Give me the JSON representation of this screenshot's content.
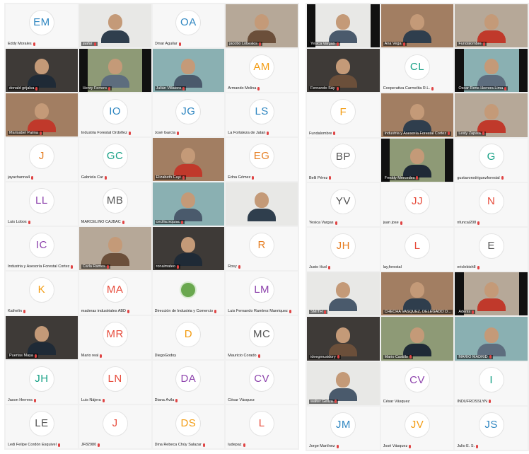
{
  "left_gallery": {
    "tiles": [
      {
        "initials": "EM",
        "name": "Eddy Morales",
        "initials_color": "#2e86c1",
        "mic_muted": true
      },
      {
        "name": "jaafar",
        "video": true,
        "active": true,
        "mic_muted": true
      },
      {
        "initials": "OA",
        "name": "Omar Aguilar",
        "initials_color": "#2e86c1",
        "mic_muted": true
      },
      {
        "name": "jacobo Lobeslos",
        "video": true,
        "mic_muted": true
      },
      {
        "name": "donald grijalva",
        "video": true,
        "mic_muted": true
      },
      {
        "name": "Henry Ferrero",
        "video": true,
        "mic_muted": true
      },
      {
        "name": "Julián Villatoro",
        "video": true,
        "mic_muted": true
      },
      {
        "initials": "AM",
        "name": "Armando Molina",
        "initials_color": "#f39c12",
        "mic_muted": true
      },
      {
        "name": "Marisabel Palma",
        "video": true,
        "mic_muted": true
      },
      {
        "initials": "IO",
        "name": "Industria Forestal Ordoñez",
        "initials_color": "#2e86c1",
        "mic_muted": true
      },
      {
        "initials": "JG",
        "name": "José García",
        "initials_color": "#2e86c1",
        "mic_muted": true
      },
      {
        "initials": "LS",
        "name": "La Fortaleza de Jatan",
        "initials_color": "#2e86c1",
        "mic_muted": true
      },
      {
        "initials": "J",
        "name": "jayachanna4",
        "initials_color": "#e67e22",
        "mic_muted": true
      },
      {
        "initials": "GC",
        "name": "Gabriela Car",
        "initials_color": "#16a085",
        "mic_muted": true
      },
      {
        "name": "Elizabeth Cuyi",
        "video": true,
        "mic_muted": true
      },
      {
        "initials": "EG",
        "name": "Edna Gómez",
        "initials_color": "#e67e22",
        "mic_muted": true
      },
      {
        "initials": "LL",
        "name": "Luis Lobos",
        "initials_color": "#8e44ad",
        "mic_muted": true
      },
      {
        "initials": "MB",
        "name": "MARCELINO CAJBAC",
        "initials_color": "#555555",
        "mic_muted": true
      },
      {
        "name": "cecilia.ixquiac",
        "video": true,
        "mic_muted": true
      },
      {
        "name": "",
        "video": true,
        "mic_muted": false
      },
      {
        "initials": "IC",
        "name": "Industria y Asesoría Forestal Cortez",
        "initials_color": "#8e44ad",
        "mic_muted": true
      },
      {
        "name": "Carla Ramos",
        "video": true,
        "mic_muted": true
      },
      {
        "name": "ronaimateo",
        "video": true,
        "mic_muted": true
      },
      {
        "initials": "R",
        "name": "Rosy",
        "initials_color": "#e67e22",
        "mic_muted": true
      },
      {
        "initials": "K",
        "name": "Kathelin",
        "initials_color": "#f39c12",
        "mic_muted": true
      },
      {
        "initials": "MA",
        "name": "maderas industriales ABD",
        "initials_color": "#e74c3c",
        "mic_muted": true
      },
      {
        "name": "Dirección de Industria y Comercio",
        "logo": true,
        "mic_muted": true
      },
      {
        "initials": "LM",
        "name": "Luis Fernando Ramírez Manriquez",
        "initials_color": "#8e44ad",
        "mic_muted": true
      },
      {
        "name": "Puertas Maya",
        "video": true,
        "mic_muted": true
      },
      {
        "initials": "MR",
        "name": "Mario real",
        "initials_color": "#e74c3c",
        "mic_muted": true
      },
      {
        "initials": "D",
        "name": "DiegoGodoy",
        "initials_color": "#f39c12",
        "mic_muted": false
      },
      {
        "initials": "MC",
        "name": "Mauricio Corado",
        "initials_color": "#555555",
        "mic_muted": true
      },
      {
        "initials": "JH",
        "name": "Jason Herrera",
        "initials_color": "#16a085",
        "mic_muted": true
      },
      {
        "initials": "LN",
        "name": "Luis Nájera",
        "initials_color": "#e74c3c",
        "mic_muted": true
      },
      {
        "initials": "DA",
        "name": "Diana Ávila",
        "initials_color": "#8e44ad",
        "mic_muted": true
      },
      {
        "initials": "CV",
        "name": "César Vásquez",
        "initials_color": "#8e44ad",
        "mic_muted": false
      },
      {
        "initials": "LE",
        "name": "Ledi Felipe Cordón Esquivel",
        "initials_color": "#555555",
        "mic_muted": true
      },
      {
        "initials": "J",
        "name": "JF82980",
        "initials_color": "#e74c3c",
        "mic_muted": true
      },
      {
        "initials": "DS",
        "name": "Dina Rebeca Chúy Salazar",
        "initials_color": "#f39c12",
        "mic_muted": true
      },
      {
        "initials": "L",
        "name": "ludepaz",
        "initials_color": "#e74c3c",
        "mic_muted": true
      }
    ]
  },
  "right_gallery": {
    "tiles": [
      {
        "name": "Yesica Vargas",
        "video": true,
        "mic_muted": true
      },
      {
        "name": "Ana Vega",
        "video": true,
        "mic_muted": true
      },
      {
        "name": "Fundalombre",
        "video": true,
        "mic_muted": true
      },
      {
        "name": "Fernando Sáy",
        "video": true,
        "active": true,
        "mic_muted": true
      },
      {
        "initials": "CL",
        "name": "Cooperativa Carmelita R.L.",
        "initials_color": "#16a085",
        "mic_muted": true
      },
      {
        "name": "Óscar Rene Herrera Lima",
        "video": true,
        "mic_muted": true
      },
      {
        "initials": "F",
        "name": "Fundalombre",
        "initials_color": "#f39c12",
        "mic_muted": true
      },
      {
        "name": "Industria y Asesoría Forestal Cortez",
        "video": true,
        "mic_muted": true
      },
      {
        "name": "Lesly Zapata",
        "video": true,
        "mic_muted": true
      },
      {
        "initials": "BP",
        "name": "Belli Pérez",
        "initials_color": "#555555",
        "mic_muted": true
      },
      {
        "name": "Freddy Mercedes",
        "video": true,
        "mic_muted": true
      },
      {
        "initials": "G",
        "name": "gustavorodriguezforestal",
        "initials_color": "#16a085",
        "mic_muted": true
      },
      {
        "initials": "YV",
        "name": "Yesica Vargas",
        "initials_color": "#555555",
        "mic_muted": true
      },
      {
        "initials": "JJ",
        "name": "juan jose",
        "initials_color": "#e74c3c",
        "mic_muted": true
      },
      {
        "initials": "N",
        "name": "nfuncai208",
        "initials_color": "#e74c3c",
        "mic_muted": true
      },
      {
        "initials": "JH",
        "name": "Justo Hud",
        "initials_color": "#e67e22",
        "mic_muted": true
      },
      {
        "initials": "L",
        "name": "lay,forestal",
        "initials_color": "#e74c3c",
        "mic_muted": false
      },
      {
        "initials": "E",
        "name": "ericlebish8",
        "initials_color": "#555555",
        "mic_muted": true
      },
      {
        "name": "SMITH",
        "video": true,
        "mic_muted": true
      },
      {
        "name": "CHECHA VASQUEZ, DELEGADO D...",
        "video": true,
        "mic_muted": true
      },
      {
        "name": "Adenis",
        "video": true,
        "mic_muted": true
      },
      {
        "name": "ideegmusidory",
        "video": true,
        "mic_muted": true
      },
      {
        "name": "Mario Castillo",
        "video": true,
        "mic_muted": true
      },
      {
        "name": "MARIO MADRID",
        "video": true,
        "mic_muted": true
      },
      {
        "name": "walter Geliza",
        "video": true,
        "mic_muted": true
      },
      {
        "initials": "CV",
        "name": "César Vásquez",
        "initials_color": "#8e44ad",
        "mic_muted": false
      },
      {
        "initials": "I",
        "name": "INDUFROSSLYN",
        "initials_color": "#16a085",
        "mic_muted": true
      },
      {
        "initials": "JM",
        "name": "Jorge Martínez",
        "initials_color": "#2e86c1",
        "mic_muted": true
      },
      {
        "initials": "JV",
        "name": "José Vásquez",
        "initials_color": "#f39c12",
        "mic_muted": true
      },
      {
        "initials": "JS",
        "name": "Julio E. S.",
        "initials_color": "#2e86c1",
        "mic_muted": true
      }
    ]
  }
}
